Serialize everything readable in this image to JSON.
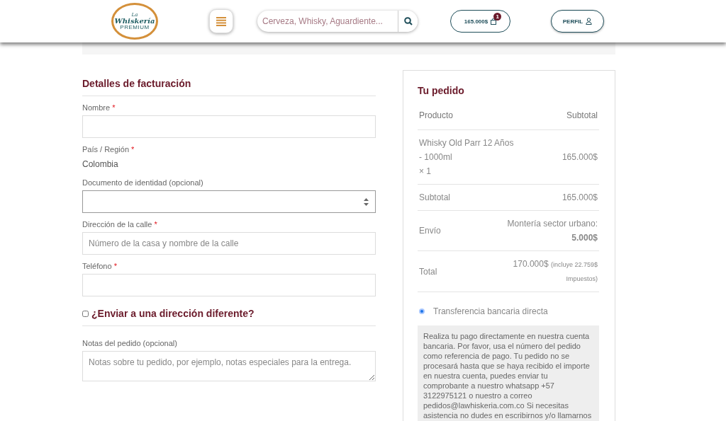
{
  "header": {
    "logo": {
      "script_top": "La",
      "script": "Whiskería",
      "tagline": "PREMIUM"
    },
    "search": {
      "placeholder": "Cerveza, Whisky, Aguardiente..."
    },
    "cart": {
      "amount": "165.000$",
      "count": "1"
    },
    "profile": {
      "label": "PERFIL"
    }
  },
  "billing": {
    "title": "Detalles de facturación",
    "fields": [
      {
        "kind": "input",
        "label": "Nombre",
        "required_mark": "*"
      },
      {
        "kind": "static",
        "label": "País / Región",
        "required_mark": "*",
        "value": "Colombia"
      },
      {
        "kind": "select",
        "label": "Documento de identidad (opcional)"
      },
      {
        "kind": "input",
        "label": "Dirección de la calle",
        "required_mark": "*",
        "placeholder": "Número de la casa y nombre de la calle"
      },
      {
        "kind": "input",
        "label": "Teléfono",
        "required_mark": "*"
      }
    ]
  },
  "ship_different": {
    "label": "¿Enviar a una dirección diferente?",
    "checked": false
  },
  "notes": {
    "label": "Notas del pedido (opcional)",
    "placeholder": "Notas sobre tu pedido, por ejemplo, notas especiales para la entrega."
  },
  "order": {
    "title": "Tu pedido",
    "columns": [
      "Producto",
      "Subtotal"
    ],
    "items": [
      {
        "name": "Whisky Old Parr 12 Años - 1000ml",
        "quantity": "× 1",
        "subtotal": "165.000$"
      }
    ],
    "rows": [
      {
        "label": "Subtotal",
        "value": "165.000$"
      },
      {
        "label": "Envío",
        "value": "Montería sector urbano: **5.000$**"
      },
      {
        "label": "Total",
        "value": "170.000$",
        "note": "(incluye 22.759$ Impuestos)"
      }
    ]
  },
  "payment": {
    "methods": [
      {
        "label": "Transferencia bancaria directa",
        "selected": true
      }
    ],
    "description": "Realiza tu pago directamente en nuestra cuenta bancaria. Por favor, usa el número del pedido como referencia de pago. Tu pedido no se procesará hasta que se haya recibido el importe en nuestra cuenta, puedes enviar tu comprobante a nuestro whatsapp +57 3122975121 o nuestro a correo pedidos@lawhiskeria.com.co Si necesitas asistencia no dudes en escribirnos y/o llamarnos"
  }
}
